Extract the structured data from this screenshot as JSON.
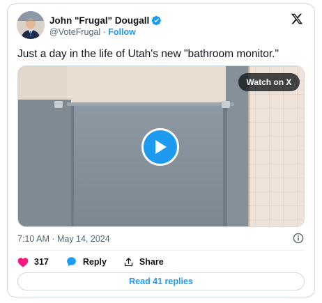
{
  "author": {
    "name": "John \"Frugal\" Dougall",
    "handle": "@VoteFrugal",
    "separator": " · ",
    "follow_label": "Follow"
  },
  "tweet": {
    "text": "Just a day in the life of Utah's new \"bathroom monitor.\"",
    "timestamp": "7:10 AM · May 14, 2024"
  },
  "media": {
    "watch_label": "Watch on X"
  },
  "actions": {
    "like_count": "317",
    "reply_label": "Reply",
    "share_label": "Share"
  },
  "read_replies_label": "Read 41 replies",
  "colors": {
    "accent": "#1d9bf0",
    "like": "#f91880",
    "text": "#0f1419",
    "muted": "#536471",
    "border": "#cfd9de"
  },
  "icons": [
    "verified-badge-icon",
    "x-logo-icon",
    "play-icon",
    "info-icon",
    "heart-icon",
    "reply-bubble-icon",
    "share-icon"
  ]
}
